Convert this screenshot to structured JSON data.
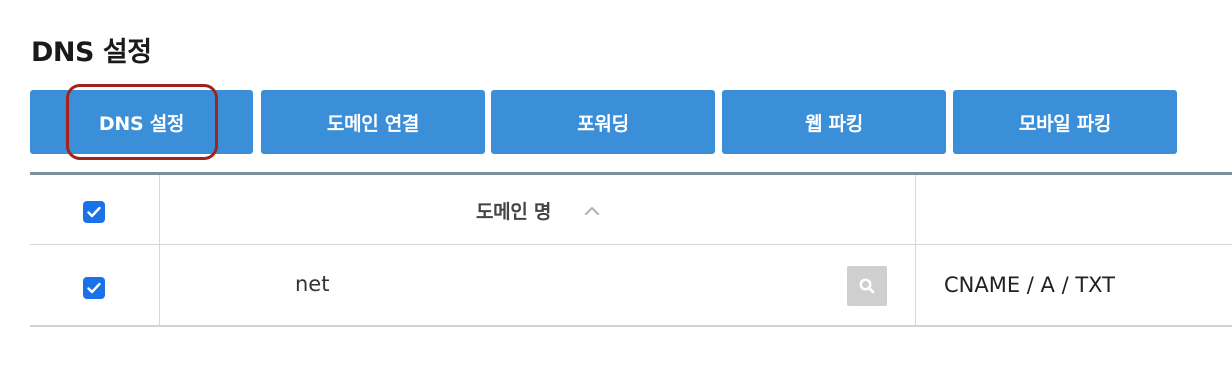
{
  "page": {
    "title": "DNS 설정"
  },
  "tabs": [
    {
      "label": "DNS 설정",
      "active": true
    },
    {
      "label": "도메인 연결"
    },
    {
      "label": "포워딩"
    },
    {
      "label": "웹 파킹"
    },
    {
      "label": "모바일 파킹"
    }
  ],
  "colors": {
    "tab_bg": "#3a8fd8",
    "highlight": "#a3231b",
    "checkbox": "#1b72e8"
  },
  "table": {
    "header": {
      "domain_col": "도메인 명",
      "select_all_checked": true,
      "sort": "ascending"
    },
    "rows": [
      {
        "checked": true,
        "domain": "net",
        "records": "CNAME / A / TXT"
      }
    ]
  },
  "icons": {
    "sort": "chevron-up-icon",
    "search": "search-icon",
    "check": "check-icon"
  }
}
